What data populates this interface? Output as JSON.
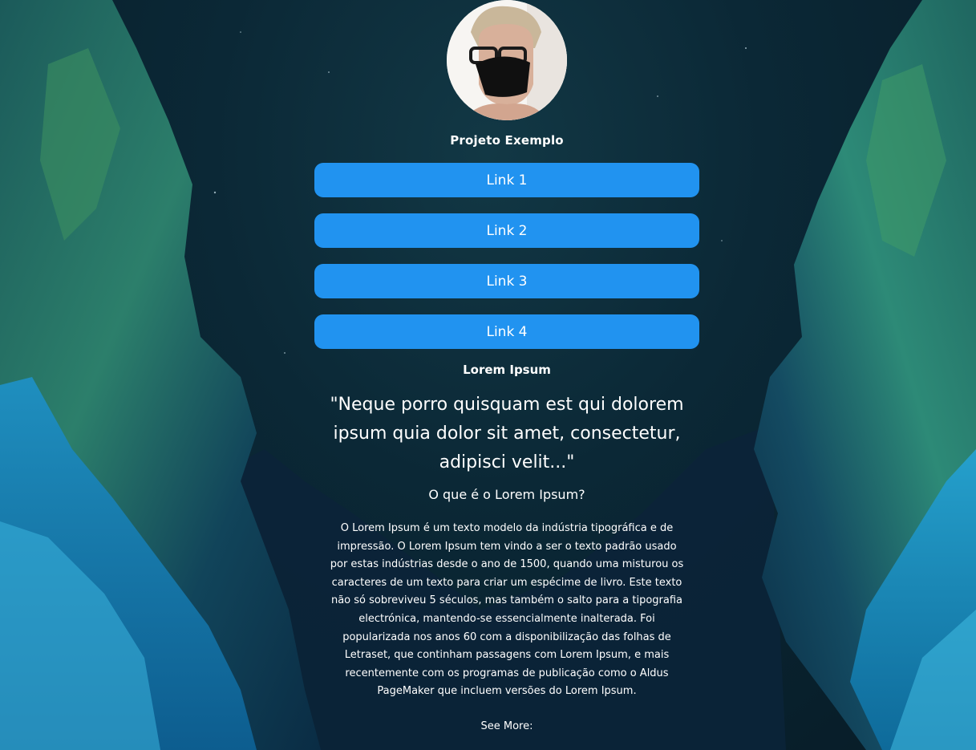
{
  "profile": {
    "avatar_alt": "profile photo",
    "title": "Projeto Exemplo"
  },
  "links": [
    {
      "label": "Link 1"
    },
    {
      "label": "Link 2"
    },
    {
      "label": "Link 3"
    },
    {
      "label": "Link 4"
    }
  ],
  "content": {
    "section_title": "Lorem Ipsum",
    "quote": "\"Neque porro quisquam est qui dolorem ipsum quia dolor sit amet, consectetur, adipisci velit...\"",
    "subheading": "O que é o Lorem Ipsum?",
    "body": "O Lorem Ipsum é um texto modelo da indústria tipográfica e de impressão. O Lorem Ipsum tem vindo a ser o texto padrão usado por estas indústrias desde o ano de 1500, quando uma misturou os caracteres de um texto para criar um espécime de livro. Este texto não só sobreviveu 5 séculos, mas também o salto para a tipografia electrónica, mantendo-se essencialmente inalterada. Foi popularizada nos anos 60 com a disponibilização das folhas de Letraset, que continham passagens com Lorem Ipsum, e mais recentemente com os programas de publicação como o Aldus PageMaker que incluem versões do Lorem Ipsum.",
    "see_more": "See More:"
  },
  "colors": {
    "button": "#2193f0",
    "text": "#ffffff",
    "background": "#0a2a3a"
  },
  "icons": {
    "background": "mountain-night-background"
  }
}
